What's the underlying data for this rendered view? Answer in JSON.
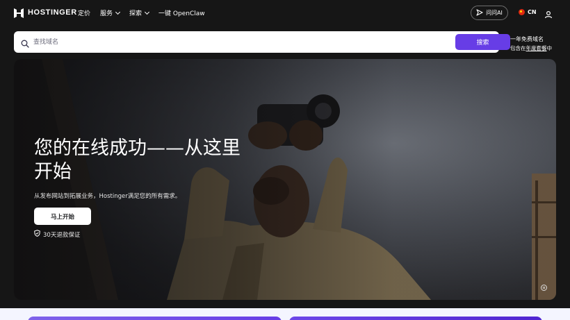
{
  "brand": {
    "name": "HOSTINGER"
  },
  "nav": {
    "items": [
      {
        "label": "定价",
        "has_dropdown": false
      },
      {
        "label": "服务",
        "has_dropdown": true
      },
      {
        "label": "探索",
        "has_dropdown": true
      },
      {
        "label": "一键 OpenClaw",
        "has_dropdown": false
      }
    ],
    "ask_ai_label": "问问AI",
    "language": "CN",
    "icons": {
      "ask_ai": "sparkle-icon",
      "flag": "china-flag-icon",
      "account": "user-icon"
    }
  },
  "search": {
    "placeholder": "查找域名",
    "value": "",
    "button_label": "搜索",
    "icon": "search-icon"
  },
  "promo": {
    "line1": "一年免费域名",
    "prefix": "包含在",
    "link": "年度套餐",
    "suffix": "中"
  },
  "hero": {
    "title": "您的在线成功——从这里开始",
    "subtitle": "从发布网站到拓展业务，Hostinger满足您的所有需求。",
    "cta_label": "马上开始",
    "guarantee": "30天退款保证",
    "icons": {
      "guarantee": "shield-check-icon",
      "media": "pause-icon"
    }
  },
  "colors": {
    "accent": "#673de6",
    "background": "#161616",
    "bottom_band": "#f4f5ff"
  }
}
